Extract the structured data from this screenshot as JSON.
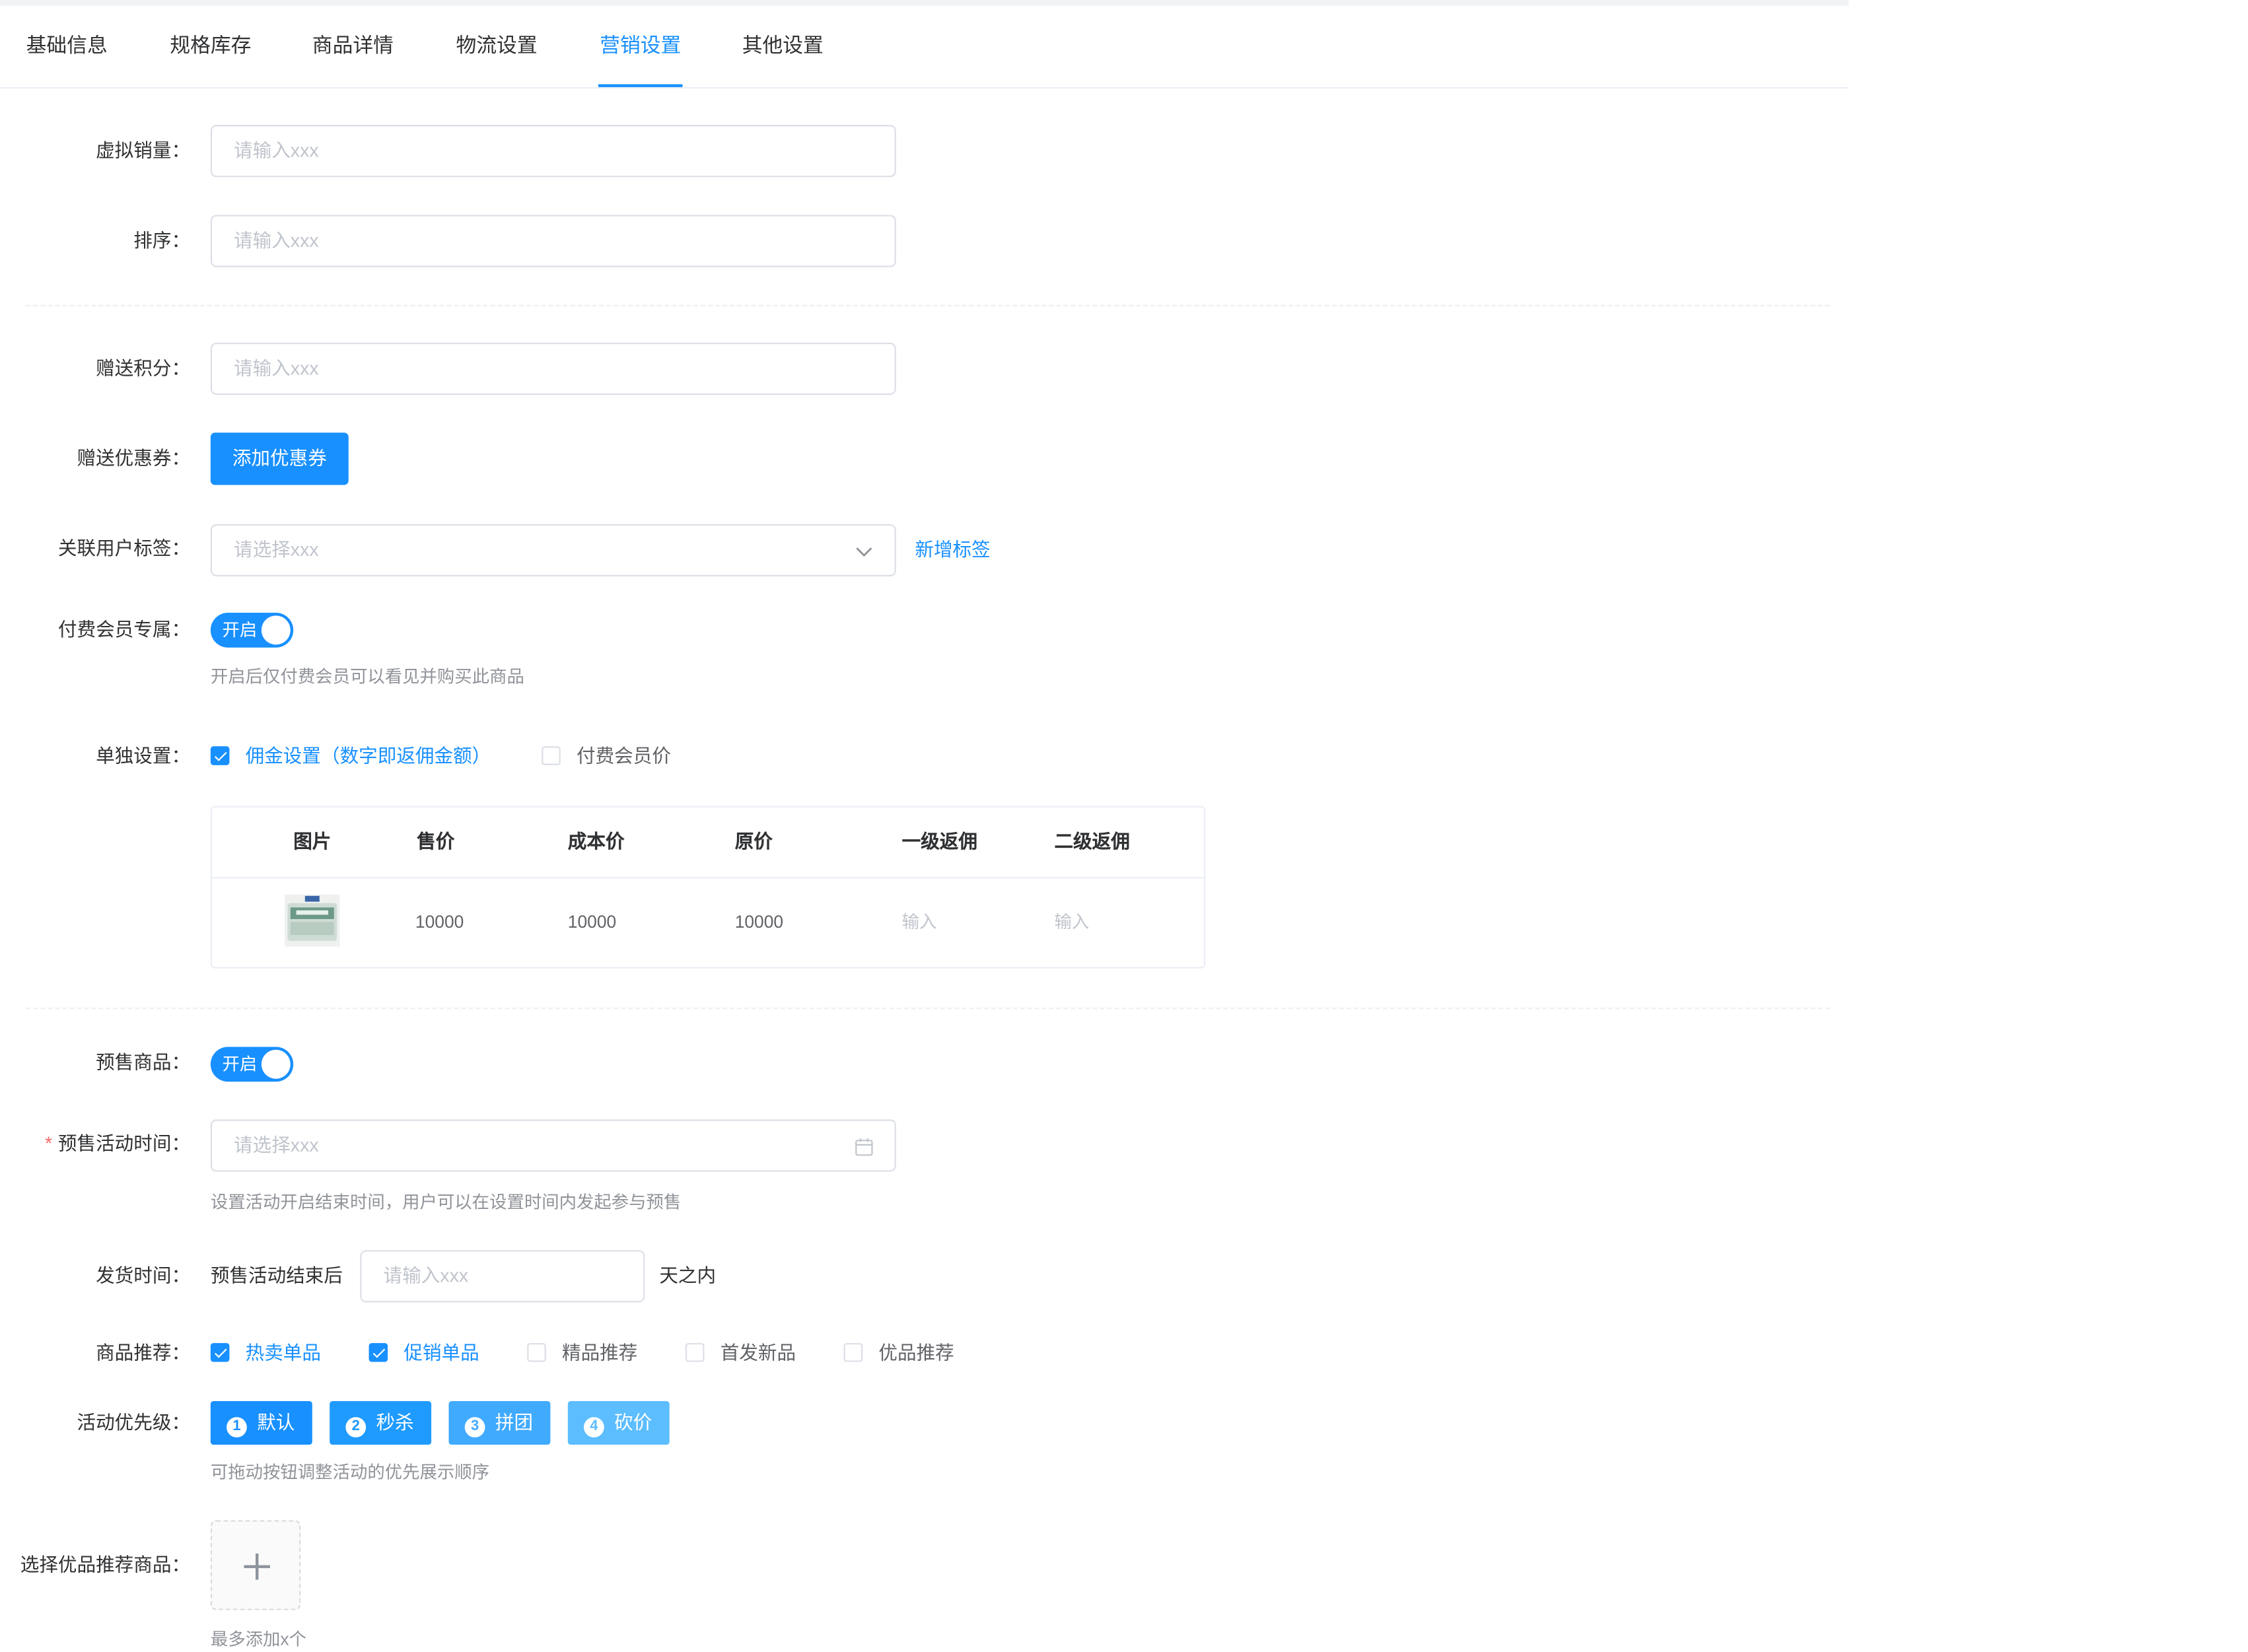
{
  "tabs": [
    "基础信息",
    "规格库存",
    "商品详情",
    "物流设置",
    "营销设置",
    "其他设置"
  ],
  "active_tab": "营销设置",
  "form": {
    "virtual_sales": {
      "label": "虚拟销量：",
      "placeholder": "请输入xxx"
    },
    "sort": {
      "label": "排序：",
      "placeholder": "请输入xxx"
    },
    "gift_points": {
      "label": "赠送积分：",
      "placeholder": "请输入xxx"
    },
    "gift_coupon": {
      "label": "赠送优惠券：",
      "button": "添加优惠券"
    },
    "user_tag": {
      "label": "关联用户标签：",
      "placeholder": "请选择xxx",
      "link": "新增标签"
    },
    "paid_member": {
      "label": "付费会员专属：",
      "switch_text": "开启",
      "hint": "开启后仅付费会员可以看见并购买此商品"
    },
    "single_setting": {
      "label": "单独设置：",
      "options": [
        {
          "label": "佣金设置（数字即返佣金额）",
          "checked": true
        },
        {
          "label": "付费会员价",
          "checked": false
        }
      ]
    },
    "table": {
      "headers": [
        "图片",
        "售价",
        "成本价",
        "原价",
        "一级返佣",
        "二级返佣"
      ],
      "row": {
        "price": "10000",
        "cost": "10000",
        "original": "10000",
        "level1_placeholder": "输入",
        "level2_placeholder": "输入"
      }
    },
    "presale": {
      "label": "预售商品：",
      "switch_text": "开启"
    },
    "presale_time": {
      "label": "预售活动时间：",
      "required_mark": "*",
      "placeholder": "请选择xxx",
      "hint": "设置活动开启结束时间，用户可以在设置时间内发起参与预售"
    },
    "ship_time": {
      "label": "发货时间：",
      "prefix": "预售活动结束后",
      "placeholder": "请输入xxx",
      "suffix": "天之内"
    },
    "recommend": {
      "label": "商品推荐：",
      "options": [
        {
          "label": "热卖单品",
          "checked": true
        },
        {
          "label": "促销单品",
          "checked": true
        },
        {
          "label": "精品推荐",
          "checked": false
        },
        {
          "label": "首发新品",
          "checked": false
        },
        {
          "label": "优品推荐",
          "checked": false
        }
      ]
    },
    "priority": {
      "label": "活动优先级：",
      "items": [
        {
          "num": "1",
          "label": "默认",
          "color": "#1890ff"
        },
        {
          "num": "2",
          "label": "秒杀",
          "color": "#1f9bff"
        },
        {
          "num": "3",
          "label": "拼团",
          "color": "#40aaff"
        },
        {
          "num": "4",
          "label": "砍价",
          "color": "#5cbdff"
        }
      ],
      "hint": "可拖动按钮调整活动的优先展示顺序"
    },
    "premium_goods": {
      "label": "选择优品推荐商品：",
      "hint": "最多添加x个"
    }
  },
  "colors": {
    "primary": "#1890ff",
    "danger": "#f56c6c"
  }
}
